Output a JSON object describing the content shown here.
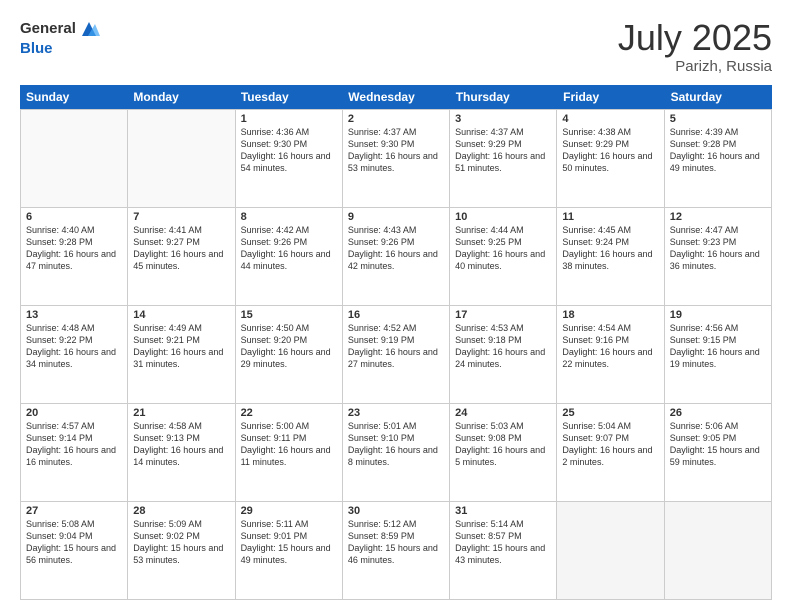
{
  "logo": {
    "general": "General",
    "blue": "Blue"
  },
  "title": {
    "month_year": "July 2025",
    "location": "Parizh, Russia"
  },
  "header_days": [
    "Sunday",
    "Monday",
    "Tuesday",
    "Wednesday",
    "Thursday",
    "Friday",
    "Saturday"
  ],
  "weeks": [
    [
      {
        "day": "",
        "empty": true
      },
      {
        "day": "",
        "empty": true
      },
      {
        "day": "1",
        "sunrise": "Sunrise: 4:36 AM",
        "sunset": "Sunset: 9:30 PM",
        "daylight": "Daylight: 16 hours and 54 minutes."
      },
      {
        "day": "2",
        "sunrise": "Sunrise: 4:37 AM",
        "sunset": "Sunset: 9:30 PM",
        "daylight": "Daylight: 16 hours and 53 minutes."
      },
      {
        "day": "3",
        "sunrise": "Sunrise: 4:37 AM",
        "sunset": "Sunset: 9:29 PM",
        "daylight": "Daylight: 16 hours and 51 minutes."
      },
      {
        "day": "4",
        "sunrise": "Sunrise: 4:38 AM",
        "sunset": "Sunset: 9:29 PM",
        "daylight": "Daylight: 16 hours and 50 minutes."
      },
      {
        "day": "5",
        "sunrise": "Sunrise: 4:39 AM",
        "sunset": "Sunset: 9:28 PM",
        "daylight": "Daylight: 16 hours and 49 minutes."
      }
    ],
    [
      {
        "day": "6",
        "sunrise": "Sunrise: 4:40 AM",
        "sunset": "Sunset: 9:28 PM",
        "daylight": "Daylight: 16 hours and 47 minutes."
      },
      {
        "day": "7",
        "sunrise": "Sunrise: 4:41 AM",
        "sunset": "Sunset: 9:27 PM",
        "daylight": "Daylight: 16 hours and 45 minutes."
      },
      {
        "day": "8",
        "sunrise": "Sunrise: 4:42 AM",
        "sunset": "Sunset: 9:26 PM",
        "daylight": "Daylight: 16 hours and 44 minutes."
      },
      {
        "day": "9",
        "sunrise": "Sunrise: 4:43 AM",
        "sunset": "Sunset: 9:26 PM",
        "daylight": "Daylight: 16 hours and 42 minutes."
      },
      {
        "day": "10",
        "sunrise": "Sunrise: 4:44 AM",
        "sunset": "Sunset: 9:25 PM",
        "daylight": "Daylight: 16 hours and 40 minutes."
      },
      {
        "day": "11",
        "sunrise": "Sunrise: 4:45 AM",
        "sunset": "Sunset: 9:24 PM",
        "daylight": "Daylight: 16 hours and 38 minutes."
      },
      {
        "day": "12",
        "sunrise": "Sunrise: 4:47 AM",
        "sunset": "Sunset: 9:23 PM",
        "daylight": "Daylight: 16 hours and 36 minutes."
      }
    ],
    [
      {
        "day": "13",
        "sunrise": "Sunrise: 4:48 AM",
        "sunset": "Sunset: 9:22 PM",
        "daylight": "Daylight: 16 hours and 34 minutes."
      },
      {
        "day": "14",
        "sunrise": "Sunrise: 4:49 AM",
        "sunset": "Sunset: 9:21 PM",
        "daylight": "Daylight: 16 hours and 31 minutes."
      },
      {
        "day": "15",
        "sunrise": "Sunrise: 4:50 AM",
        "sunset": "Sunset: 9:20 PM",
        "daylight": "Daylight: 16 hours and 29 minutes."
      },
      {
        "day": "16",
        "sunrise": "Sunrise: 4:52 AM",
        "sunset": "Sunset: 9:19 PM",
        "daylight": "Daylight: 16 hours and 27 minutes."
      },
      {
        "day": "17",
        "sunrise": "Sunrise: 4:53 AM",
        "sunset": "Sunset: 9:18 PM",
        "daylight": "Daylight: 16 hours and 24 minutes."
      },
      {
        "day": "18",
        "sunrise": "Sunrise: 4:54 AM",
        "sunset": "Sunset: 9:16 PM",
        "daylight": "Daylight: 16 hours and 22 minutes."
      },
      {
        "day": "19",
        "sunrise": "Sunrise: 4:56 AM",
        "sunset": "Sunset: 9:15 PM",
        "daylight": "Daylight: 16 hours and 19 minutes."
      }
    ],
    [
      {
        "day": "20",
        "sunrise": "Sunrise: 4:57 AM",
        "sunset": "Sunset: 9:14 PM",
        "daylight": "Daylight: 16 hours and 16 minutes."
      },
      {
        "day": "21",
        "sunrise": "Sunrise: 4:58 AM",
        "sunset": "Sunset: 9:13 PM",
        "daylight": "Daylight: 16 hours and 14 minutes."
      },
      {
        "day": "22",
        "sunrise": "Sunrise: 5:00 AM",
        "sunset": "Sunset: 9:11 PM",
        "daylight": "Daylight: 16 hours and 11 minutes."
      },
      {
        "day": "23",
        "sunrise": "Sunrise: 5:01 AM",
        "sunset": "Sunset: 9:10 PM",
        "daylight": "Daylight: 16 hours and 8 minutes."
      },
      {
        "day": "24",
        "sunrise": "Sunrise: 5:03 AM",
        "sunset": "Sunset: 9:08 PM",
        "daylight": "Daylight: 16 hours and 5 minutes."
      },
      {
        "day": "25",
        "sunrise": "Sunrise: 5:04 AM",
        "sunset": "Sunset: 9:07 PM",
        "daylight": "Daylight: 16 hours and 2 minutes."
      },
      {
        "day": "26",
        "sunrise": "Sunrise: 5:06 AM",
        "sunset": "Sunset: 9:05 PM",
        "daylight": "Daylight: 15 hours and 59 minutes."
      }
    ],
    [
      {
        "day": "27",
        "sunrise": "Sunrise: 5:08 AM",
        "sunset": "Sunset: 9:04 PM",
        "daylight": "Daylight: 15 hours and 56 minutes."
      },
      {
        "day": "28",
        "sunrise": "Sunrise: 5:09 AM",
        "sunset": "Sunset: 9:02 PM",
        "daylight": "Daylight: 15 hours and 53 minutes."
      },
      {
        "day": "29",
        "sunrise": "Sunrise: 5:11 AM",
        "sunset": "Sunset: 9:01 PM",
        "daylight": "Daylight: 15 hours and 49 minutes."
      },
      {
        "day": "30",
        "sunrise": "Sunrise: 5:12 AM",
        "sunset": "Sunset: 8:59 PM",
        "daylight": "Daylight: 15 hours and 46 minutes."
      },
      {
        "day": "31",
        "sunrise": "Sunrise: 5:14 AM",
        "sunset": "Sunset: 8:57 PM",
        "daylight": "Daylight: 15 hours and 43 minutes."
      },
      {
        "day": "",
        "empty": true,
        "last": true
      },
      {
        "day": "",
        "empty": true,
        "last": true
      }
    ]
  ]
}
